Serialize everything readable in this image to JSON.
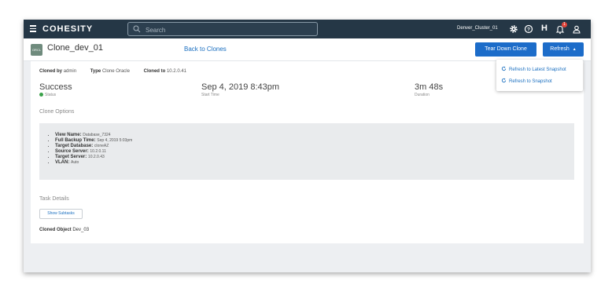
{
  "topbar": {
    "logo": "COHESITY",
    "search_placeholder": "Search",
    "cluster_name": "Denver_Cluster_01",
    "help_glyph": "H",
    "notification_count": "1",
    "icons": [
      "menu-icon",
      "search-icon",
      "gear-icon",
      "help-icon",
      "bell-icon",
      "user-icon"
    ]
  },
  "header": {
    "db_badge": "ORCL",
    "title": "Clone_dev_01",
    "back_link": "Back to Clones",
    "teardown_label": "Tear Down Clone",
    "refresh_label": "Refresh"
  },
  "refresh_menu": {
    "items": [
      "Refresh to Latest Snapshot",
      "Refresh to Snapshot"
    ]
  },
  "meta": {
    "cloned_by_label": "Cloned by",
    "cloned_by_value": "admin",
    "type_label": "Type",
    "type_value": "Clone Oracle",
    "cloned_to_label": "Cloned to",
    "cloned_to_value": "10.2.0.41"
  },
  "stats": {
    "status_value": "Success",
    "status_label": "Status",
    "start_time_value": "Sep 4, 2019 8:43pm",
    "start_time_label": "Start Time",
    "duration_value": "3m 48s",
    "duration_label": "Duration"
  },
  "clone_options": {
    "title": "Clone Options",
    "items": [
      {
        "key": "View Name:",
        "value": "Database_7324"
      },
      {
        "key": "Full Backup Time:",
        "value": "Sep 4, 2019 5:03pm"
      },
      {
        "key": "Target Database:",
        "value": "cloneAZ"
      },
      {
        "key": "Source Server:",
        "value": "10.2.0.11"
      },
      {
        "key": "Target Server:",
        "value": "10.2.0.43"
      },
      {
        "key": "VLAN:",
        "value": "Auto"
      }
    ]
  },
  "task_details": {
    "title": "Task Details",
    "show_subtasks_label": "Show Subtasks",
    "cloned_object_label": "Cloned Object",
    "cloned_object_value": "Dev_03"
  },
  "colors": {
    "topbar": "#253746",
    "primary": "#1c6cc9",
    "link": "#1a6fc0",
    "success": "#3aa14a",
    "badge": "#e0443a"
  }
}
